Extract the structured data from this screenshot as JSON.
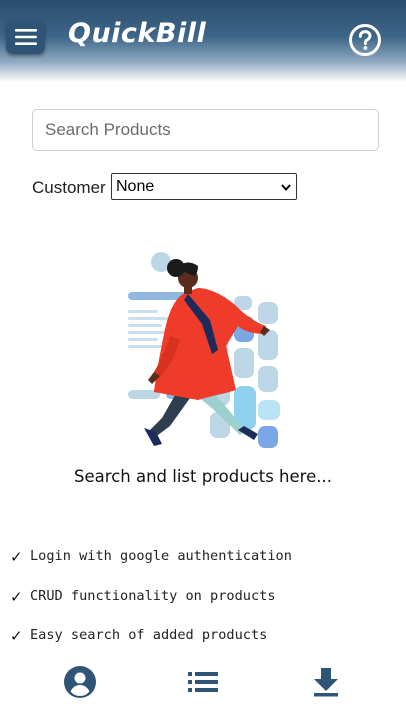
{
  "app": {
    "title": "QuickBill"
  },
  "header": {
    "menu_icon": "hamburger-menu-icon",
    "help_icon": "help-circle-icon"
  },
  "search": {
    "placeholder": "Search Products",
    "value": ""
  },
  "customer": {
    "label": "Customer",
    "selected": "None"
  },
  "empty_state": {
    "message": "Search and list products here..."
  },
  "features": [
    {
      "check": "✓",
      "text": "Login with google authentication"
    },
    {
      "check": "✓",
      "text": "CRUD functionality on products"
    },
    {
      "check": "✓",
      "text": "Easy search of added products"
    }
  ],
  "bottom_nav": [
    {
      "icon": "account-circle-icon"
    },
    {
      "icon": "list-icon"
    },
    {
      "icon": "download-icon"
    }
  ],
  "colors": {
    "header_dark": "#2a4d6e",
    "accent": "#2f5475",
    "figure_coat": "#ef3b2a",
    "chips": "#bcd6e6"
  }
}
